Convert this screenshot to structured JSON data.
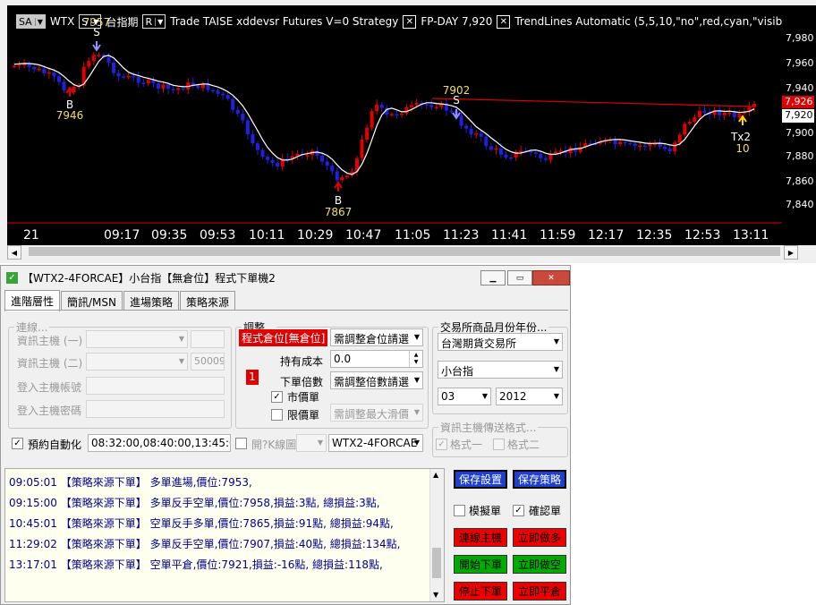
{
  "chart": {
    "toolbar": {
      "sa": "SA",
      "symbol": "WTX",
      "s_combo": "S",
      "product": "台指期",
      "r_combo": "R",
      "strategy_text": "Trade TAISE xddevsr Futures V=0 Strategy",
      "fp_day": "FP-DAY 7,920",
      "trendlines": "TrendLines Automatic (5,5,10,\"no\",red,cyan,\"visibler\")"
    },
    "y_labels": [
      "7,980",
      "7,960",
      "7,940",
      "7,900",
      "7,880",
      "7,860",
      "7,840"
    ],
    "price_red": "7,926",
    "price_white": "7,920",
    "x_labels": [
      "21",
      "09:17",
      "09:35",
      "09:53",
      "10:11",
      "10:29",
      "10:47",
      "11:05",
      "11:23",
      "11:41",
      "11:59",
      "12:17",
      "12:35",
      "12:53",
      "13:11"
    ],
    "annotations": {
      "s1_price": "7957",
      "s1_label": "S",
      "b1_label": "B",
      "b1_price": "7946",
      "b2_label": "B",
      "b2_price": "7867",
      "s2_label": "S",
      "s2_price": "7902",
      "tx_label": "Tx2",
      "tx_qty": "10"
    },
    "colors": {
      "up": "#e00000",
      "down": "#2020e0",
      "ma": "#ffffff",
      "trend": "#e00000",
      "label": "#f0e060"
    }
  },
  "window": {
    "title": "【WTX2-4FORCAE】小台指【無倉位】程式下單機2",
    "tabs": [
      "進階層性",
      "簡訊/MSN",
      "進場策略",
      "策略來源"
    ],
    "connect": {
      "legend": "連線...",
      "host1_label": "資訊主機 (一)",
      "host2_label": "資訊主機 (二)",
      "host2_port": "50009",
      "account_label": "登入主機帳號",
      "password_label": "登入主機密碼"
    },
    "adjust": {
      "legend": "調整...",
      "position_tag": "程式倉位[無倉位]",
      "position_select": "需調整倉位請選",
      "cost_label": "持有成本",
      "cost_value": "0.0",
      "mult_label": "下單倍數",
      "mult_value": "1",
      "mult_select": "需調整倍數請選",
      "market_label": "市價單",
      "limit_label": "限價單",
      "slip_select": "需調整最大滑價"
    },
    "exchange": {
      "legend": "交易所商品月份年份...",
      "exchange_value": "台灣期貨交易所",
      "product_value": "小台指",
      "month_value": "03",
      "year_value": "2012"
    },
    "format": {
      "legend": "資訊主機傳送格式...",
      "fmt1": "格式一",
      "fmt2": "格式二"
    },
    "schedule": {
      "label": "預約自動化",
      "times": "08:32:00,08:40:00,13:45:00",
      "k_label": "開?K線圖",
      "source_value": "WTX2-4FORCAE"
    },
    "log": [
      {
        "time": "09:05:01",
        "tag": "【策略來源下單】",
        "msg": "多單進場,價位:7953,"
      },
      {
        "time": "09:15:00",
        "tag": "【策略來源下單】",
        "msg": "多單反手空單,價位:7958,損益:3點, 總損益:3點,"
      },
      {
        "time": "10:45:01",
        "tag": "【策略來源下單】",
        "msg": "空單反手多單,價位:7865,損益:91點, 總損益:94點,"
      },
      {
        "time": "11:29:02",
        "tag": "【策略來源下單】",
        "msg": "多單反手空單,價位:7907,損益:40點, 總損益:134點,"
      },
      {
        "time": "13:17:01",
        "tag": "【策略來源下單】",
        "msg": "空單平倉,價位:7921,損益:-16點, 總損益:118點,"
      }
    ],
    "buttons": {
      "save_settings": "保存設置",
      "save_strategy": "保存策略",
      "simulate": "模擬單",
      "confirm": "確認單",
      "connect_host": "連線主機",
      "buy_now": "立即做多",
      "start_order": "開始下單",
      "sell_now": "立即做空",
      "stop_order": "停止下單",
      "flat_now": "立即平倉"
    }
  }
}
